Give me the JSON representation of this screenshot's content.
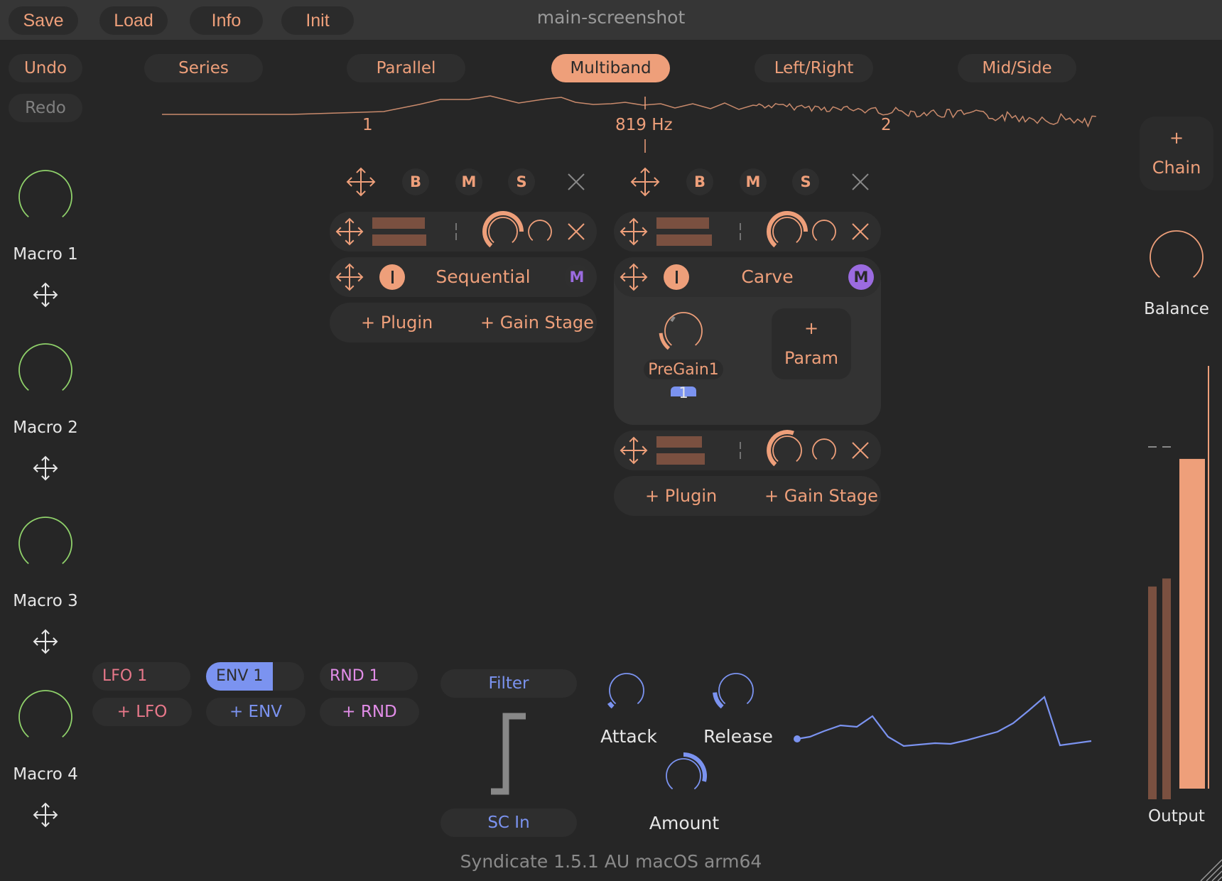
{
  "window": {
    "title": "main-screenshot"
  },
  "toolbar": {
    "save": "Save",
    "load": "Load",
    "info": "Info",
    "init": "Init"
  },
  "history": {
    "undo": "Undo",
    "redo": "Redo"
  },
  "modes": [
    {
      "label": "Series",
      "active": false
    },
    {
      "label": "Parallel",
      "active": false
    },
    {
      "label": "Multiband",
      "active": true
    },
    {
      "label": "Left/Right",
      "active": false
    },
    {
      "label": "Mid/Side",
      "active": false
    }
  ],
  "spectrum": {
    "band_labels": [
      "1",
      "2"
    ],
    "crossover_label": "819 Hz"
  },
  "macros": [
    {
      "label": "Macro 1",
      "value": 0
    },
    {
      "label": "Macro 2",
      "value": 0
    },
    {
      "label": "Macro 3",
      "value": 0
    },
    {
      "label": "Macro 4",
      "value": 0
    }
  ],
  "bands": [
    {
      "header_buttons": {
        "bypass": "B",
        "mute": "M",
        "solo": "S"
      },
      "chain": {
        "name": "Sequential",
        "mod_badge": "M"
      },
      "add_plugin": "+ Plugin",
      "add_gain_stage": "+ Gain Stage"
    },
    {
      "header_buttons": {
        "bypass": "B",
        "mute": "M",
        "solo": "S"
      },
      "chain": {
        "name": "Carve",
        "mod_badge": "M",
        "params": [
          {
            "label": "PreGain1",
            "mod_source_badge": "1"
          }
        ],
        "add_param_plus": "+",
        "add_param": "Param"
      },
      "add_plugin": "+ Plugin",
      "add_gain_stage": "+ Gain Stage"
    }
  ],
  "right_panel": {
    "add_chain_plus": "+",
    "add_chain": "Chain",
    "balance_label": "Balance",
    "output_label": "Output",
    "output_meter": {
      "left_level": 0.53,
      "right_level": 0.55,
      "output_level": 0.78
    }
  },
  "modulation": {
    "sources": [
      {
        "label": "LFO 1",
        "add": "+ LFO",
        "color": "#e8788a",
        "selected": false
      },
      {
        "label": "ENV 1",
        "add": "+ ENV",
        "color": "#7b93f0",
        "selected": true
      },
      {
        "label": "RND 1",
        "add": "+ RND",
        "color": "#e28de8",
        "selected": false
      }
    ],
    "envelope": {
      "filter_label": "Filter",
      "sc_in_label": "SC In",
      "attack_label": "Attack",
      "release_label": "Release",
      "amount_label": "Amount"
    }
  },
  "footer": {
    "version": "Syndicate 1.5.1 AU macOS arm64"
  },
  "colors": {
    "accent": "#ee9f7a",
    "env": "#7b93f0",
    "macro": "#8fd16a",
    "purple": "#9b6be0",
    "background": "#262626"
  }
}
